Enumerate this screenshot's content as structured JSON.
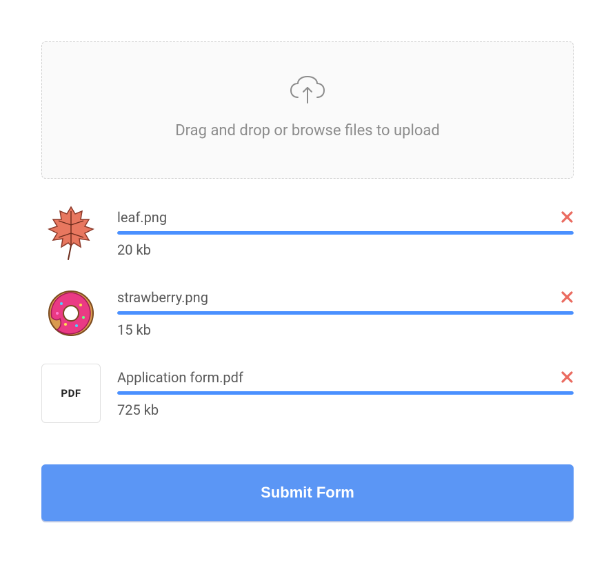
{
  "dropzone": {
    "text": "Drag and drop or browse files to upload"
  },
  "files": [
    {
      "name": "leaf.png",
      "size": "20 kb",
      "thumb": "leaf",
      "progress": 100
    },
    {
      "name": "strawberry.png",
      "size": "15 kb",
      "thumb": "donut",
      "progress": 100
    },
    {
      "name": "Application form.pdf",
      "size": "725 kb",
      "thumb": "pdf",
      "pdf_label": "PDF",
      "progress": 100
    }
  ],
  "submit": {
    "label": "Submit Form"
  },
  "colors": {
    "accent": "#5b96f5",
    "progress": "#4a90ff",
    "remove": "#ea6b60"
  }
}
